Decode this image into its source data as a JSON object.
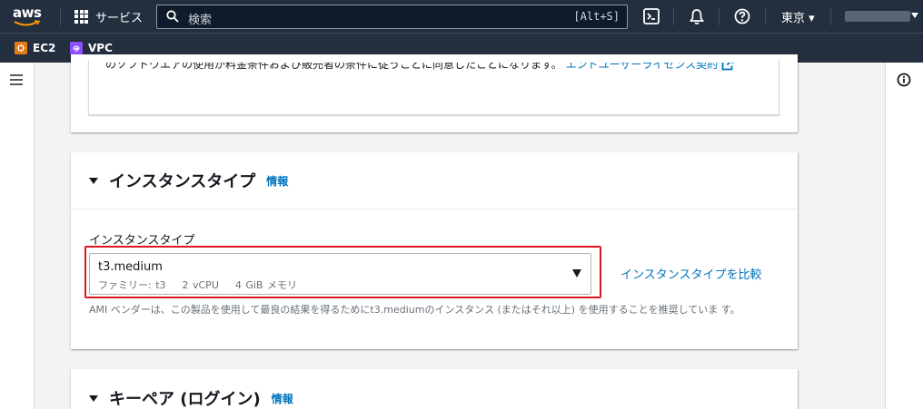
{
  "topnav": {
    "logo_text": "aws",
    "services_label": "サービス",
    "search_placeholder": "検索",
    "search_shortcut": "[Alt+S]",
    "icons": [
      "cloudshell-icon",
      "bell-icon",
      "help-icon"
    ],
    "region_label": "東京 ▾"
  },
  "favorites": [
    {
      "label": "EC2",
      "icon": "ec2-icon",
      "color": "#e47911"
    },
    {
      "label": "VPC",
      "icon": "vpc-icon",
      "color": "#8c4fff"
    }
  ],
  "license": {
    "text": "のソフトウエアの使用が料金条件および販売者の条件に従うことに同意したことになります。",
    "link": "エンドユーザーライセンス契約"
  },
  "instance_type_section": {
    "title": "インスタンスタイプ",
    "info": "情報",
    "field_label": "インスタンスタイプ",
    "selected_value": "t3.medium",
    "selected_details": "ファミリー: t3    2 vCPU    4 GiB メモリ",
    "compare_link": "インスタンスタイプを比較",
    "help_text": "AMI ベンダーは、この製品を使用して最良の結果を得るためにt3.mediumのインスタンス (またはそれ以上) を使用することを推奨していま す。"
  },
  "keypair_section": {
    "title": "キーペア (ログイン)",
    "info": "情報"
  },
  "colors": {
    "nav_bg": "#232f3e",
    "link": "#0073bb",
    "highlight": "#e0161f"
  }
}
